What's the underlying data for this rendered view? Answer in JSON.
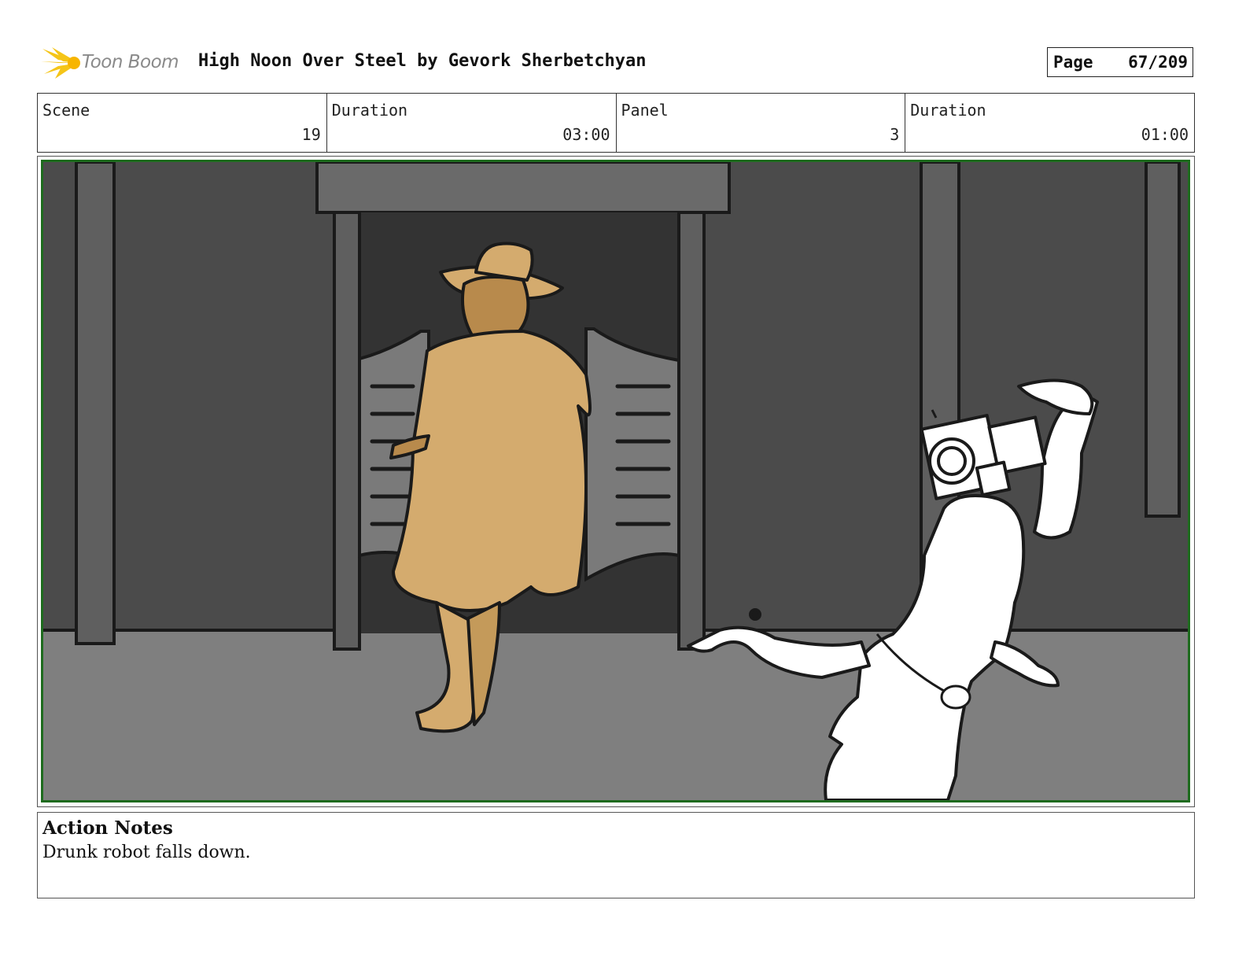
{
  "header": {
    "logo_text": "Toon Boom",
    "title": "High Noon Over Steel by Gevork Sherbetchyan",
    "page_label": "Page",
    "page_value": "67/209"
  },
  "info": {
    "scene_label": "Scene",
    "scene_value": "19",
    "scene_duration_label": "Duration",
    "scene_duration_value": "03:00",
    "panel_label": "Panel",
    "panel_value": "3",
    "panel_duration_label": "Duration",
    "panel_duration_value": "01:00"
  },
  "notes": {
    "heading": "Action Notes",
    "body": "Drunk robot falls down."
  },
  "colors": {
    "frame_border": "#1e6b1e",
    "logo_yellow": "#f5c518",
    "cowboy_coat": "#d4ab6e"
  }
}
